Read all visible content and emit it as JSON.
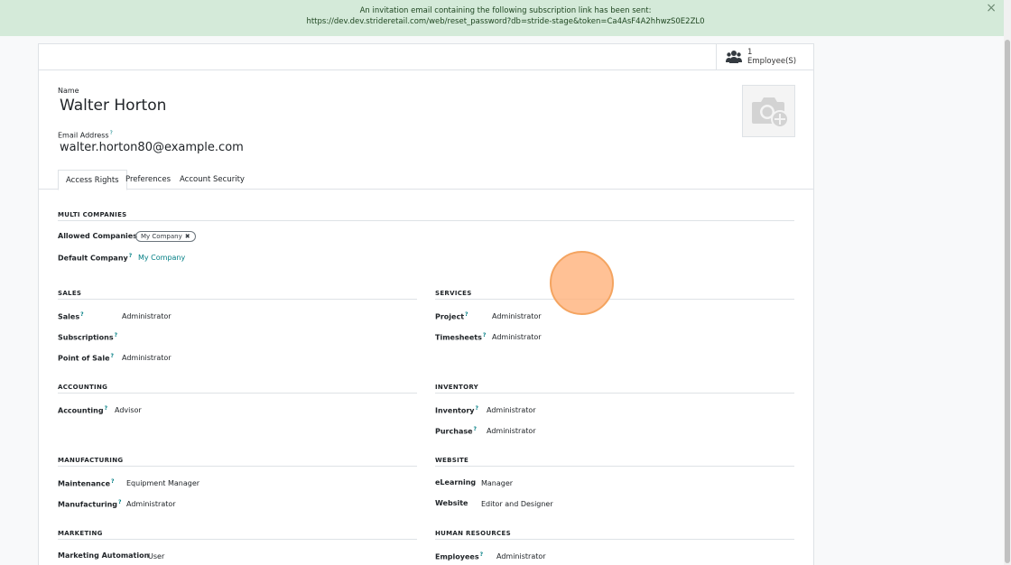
{
  "notification": {
    "line1": "An invitation email containing the following subscription link has been sent:",
    "line2": "https://dev.dev.strideretail.com/web/reset_password?db=stride-stage&token=Ca4AsF4A2hhwzS0E2ZL0",
    "close": "×"
  },
  "stat": {
    "count": "1",
    "label": "Employee(S)"
  },
  "form": {
    "name_label": "Name",
    "name_value": "Walter Horton",
    "email_label": "Email Address",
    "email_value": "walter.horton80@example.com",
    "help": "?"
  },
  "tabs": [
    "Access Rights",
    "Preferences",
    "Account Security"
  ],
  "multi": {
    "title": "MULTI COMPANIES",
    "allowed_label": "Allowed Companies",
    "allowed_tag": "My Company",
    "tag_remove": "✖",
    "default_label": "Default Company",
    "default_value": "My Company"
  },
  "sales": {
    "title": "SALES",
    "rows": [
      {
        "label": "Sales",
        "value": "Administrator"
      },
      {
        "label": "Subscriptions",
        "value": ""
      },
      {
        "label": "Point of Sale",
        "value": "Administrator"
      }
    ]
  },
  "services": {
    "title": "SERVICES",
    "rows": [
      {
        "label": "Project",
        "value": "Administrator"
      },
      {
        "label": "Timesheets",
        "value": "Administrator"
      }
    ]
  },
  "accounting": {
    "title": "ACCOUNTING",
    "rows": [
      {
        "label": "Accounting",
        "value": "Advisor"
      }
    ]
  },
  "inventory": {
    "title": "INVENTORY",
    "rows": [
      {
        "label": "Inventory",
        "value": "Administrator"
      },
      {
        "label": "Purchase",
        "value": "Administrator"
      }
    ]
  },
  "manufacturing": {
    "title": "MANUFACTURING",
    "rows": [
      {
        "label": "Maintenance",
        "value": "Equipment Manager"
      },
      {
        "label": "Manufacturing",
        "value": "Administrator"
      }
    ]
  },
  "website": {
    "title": "WEBSITE",
    "rows": [
      {
        "label": "eLearning",
        "value": "Manager"
      },
      {
        "label": "Website",
        "value": "Editor and Designer"
      }
    ]
  },
  "marketing": {
    "title": "MARKETING",
    "rows": [
      {
        "label": "Marketing Automation",
        "value": "User"
      }
    ]
  },
  "hr": {
    "title": "HUMAN RESOURCES",
    "rows": [
      {
        "label": "Employees",
        "value": "Administrator"
      }
    ]
  },
  "colors": {
    "accent": "#017e84",
    "notify_bg": "#d4ead9"
  },
  "icons": [
    "employees-icon",
    "camera-add-icon",
    "close-icon"
  ]
}
